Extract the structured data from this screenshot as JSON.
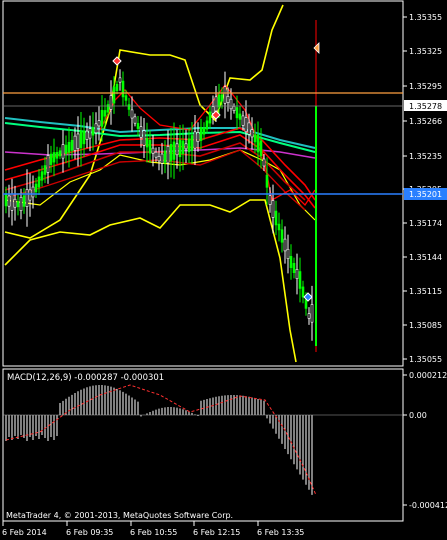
{
  "price_axis": {
    "ticks": [
      "1.35355",
      "1.35325",
      "1.35295",
      "1.35266",
      "1.35235",
      "1.35205",
      "1.35174",
      "1.35144",
      "1.35115",
      "1.35085",
      "1.35055"
    ],
    "current_price_label": "1.35278",
    "blue_line_label": "1.35201"
  },
  "macd_panel": {
    "title": "MACD(12,26,9) -0.000287 -0.000301",
    "ticks": [
      "0.000212",
      "0.00",
      "-0.000412"
    ]
  },
  "time_axis": {
    "labels": [
      "6 Feb 2014",
      "6 Feb 09:35",
      "6 Feb 10:55",
      "6 Feb 12:15",
      "6 Feb 13:35"
    ]
  },
  "copyright": "MetaTrader 4, © 2001-2013, MetaQuotes Software Corp.",
  "colors": {
    "background": "#000000",
    "bull_candle": "#00ff00",
    "bear_candle": "#ffffff",
    "bollinger": "#ffff00",
    "ma_red": "#ff0000",
    "ma_darkred": "#cc0000",
    "ma_teal": "#20c0c0",
    "ma_green": "#00ff80",
    "ma_magenta": "#cc33cc",
    "level_orange": "#ffa040",
    "level_blue": "#2a80ff",
    "macd_signal": "#ff3030"
  },
  "chart_data": {
    "type": "candlestick",
    "symbol_timeframe": "",
    "price_levels": {
      "orange_line": 1.3529,
      "current_price": 1.35278,
      "blue_line": 1.35201
    },
    "macd": {
      "value": -0.000287,
      "signal": -0.000301,
      "scale_max": 0.000212,
      "scale_min": -0.000412
    }
  }
}
